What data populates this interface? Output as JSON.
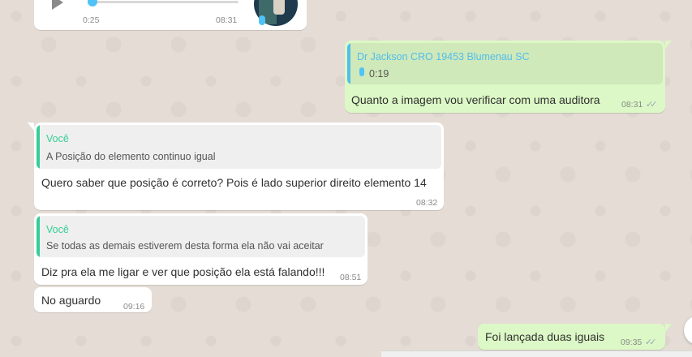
{
  "colors": {
    "chat_bg": "#e5ddd5",
    "incoming_bubble": "#ffffff",
    "outgoing_bubble": "#dcf8c6",
    "quote_author_green": "#35cd96",
    "quote_author_blue": "#53bdeb",
    "tick_gray": "#9aa9b3"
  },
  "audio_message": {
    "elapsed": "0:25",
    "time": "08:31",
    "progress_fraction": 0.03,
    "play_icon": "play-icon",
    "mic_icon": "microphone-icon"
  },
  "messages": [
    {
      "direction": "out",
      "quote_author": "Dr Jackson CRO 19453 Blumenau SC",
      "quote_audio_duration": "0:19",
      "text": "Quanto a imagem vou verificar com uma auditora",
      "time": "08:31",
      "status": "read"
    },
    {
      "direction": "in",
      "quote_author": "Você",
      "quote_text": "A Posição do elemento continuo igual",
      "text": "Quero saber que posição é correto? Pois é lado superior direito elemento 14",
      "time": "08:32"
    },
    {
      "direction": "in",
      "quote_author": "Você",
      "quote_text": "Se todas as demais estiverem desta forma ela não vai aceitar",
      "text": "Diz pra ela me ligar e ver que posição ela está falando!!!",
      "time": "08:51"
    },
    {
      "direction": "in",
      "text": "No aguardo",
      "time": "09:16"
    },
    {
      "direction": "out",
      "text": "Foi lançada duas iguais",
      "time": "09:35",
      "status": "read"
    }
  ],
  "ticks_glyph": "✓✓"
}
